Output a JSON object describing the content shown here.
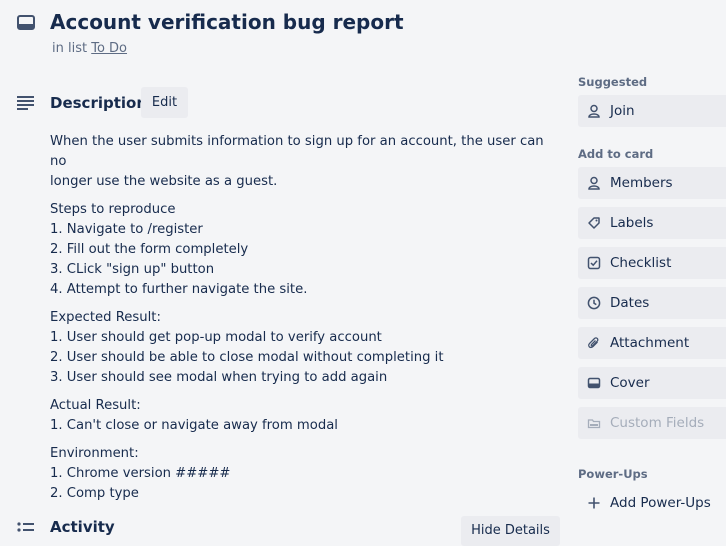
{
  "card": {
    "title": "Account verification bug report",
    "list_prefix": "in list ",
    "list_name": "To Do"
  },
  "description": {
    "heading": "Description",
    "edit_label": "Edit",
    "intro_lines": [
      "When the user submits information to sign up for an account, the user can no",
      "longer use the website as a guest."
    ],
    "steps": [
      "Steps to reproduce",
      "1. Navigate to /register",
      "2. Fill out the form completely",
      "3. CLick \"sign up\" button",
      "4. Attempt to further navigate the site."
    ],
    "expected": [
      "Expected Result:",
      "1. User should get pop-up modal to verify account",
      "2. User should be able to close modal without completing it",
      "3. User should see modal when trying to add again"
    ],
    "actual": [
      "Actual Result:",
      "1. Can't close or navigate away from modal"
    ],
    "environment": [
      "Environment:",
      "1. Chrome version #####",
      "2. Comp type"
    ]
  },
  "activity": {
    "heading": "Activity",
    "hide_details_label": "Hide Details"
  },
  "sidebar": {
    "suggested_heading": "Suggested",
    "join_label": "Join",
    "add_to_card_heading": "Add to card",
    "members_label": "Members",
    "labels_label": "Labels",
    "checklist_label": "Checklist",
    "dates_label": "Dates",
    "attachment_label": "Attachment",
    "cover_label": "Cover",
    "custom_fields_label": "Custom Fields",
    "powerups_heading": "Power-Ups",
    "add_powerups_label": "Add Power-Ups"
  },
  "colors": {
    "background": "#f4f5f7",
    "text": "#172b4d",
    "muted": "#5e6c84",
    "button_bg": "#ebecf0",
    "disabled_text": "#a5adba"
  }
}
